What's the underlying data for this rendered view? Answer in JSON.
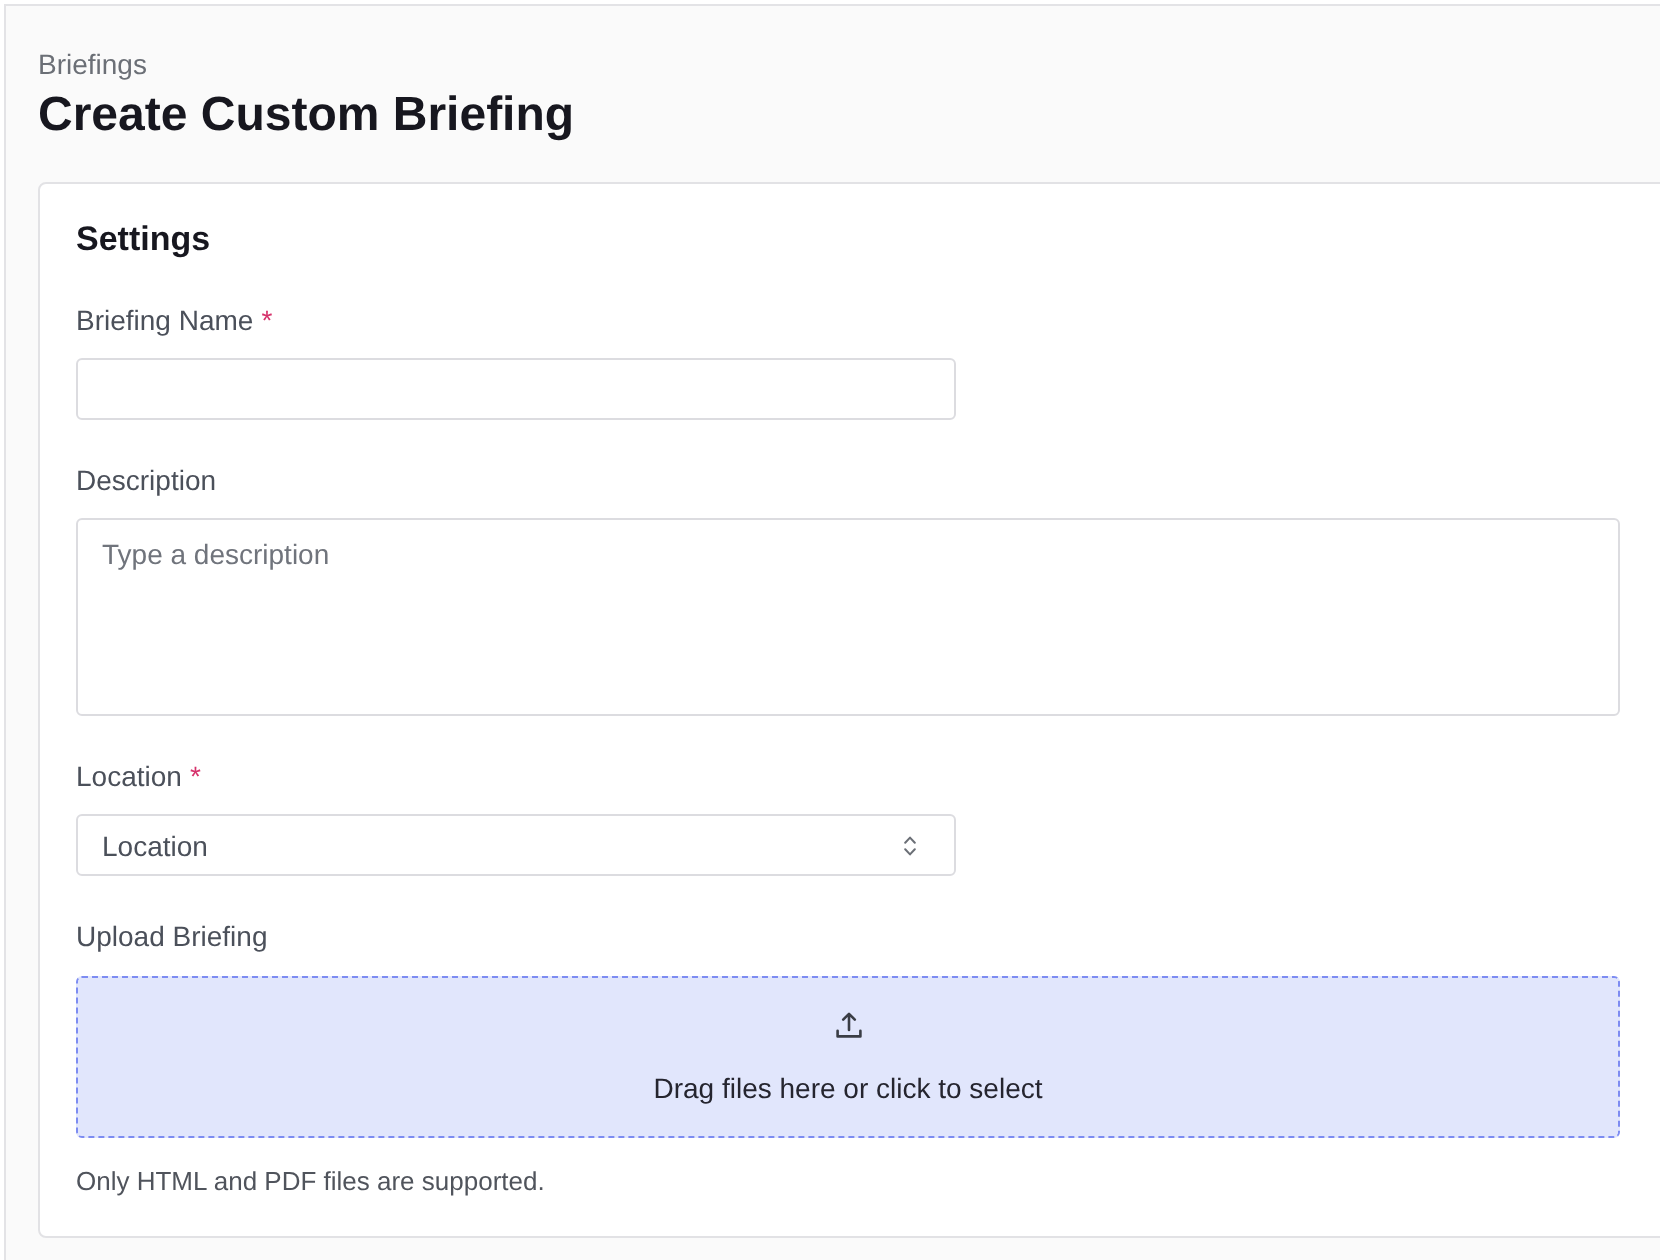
{
  "breadcrumb": "Briefings",
  "title": "Create Custom Briefing",
  "card": {
    "title": "Settings",
    "fields": [
      {
        "kind": "text",
        "label": "Briefing Name",
        "required_mark": "*"
      },
      {
        "kind": "textarea",
        "label": "Description",
        "placeholder": "Type a description"
      },
      {
        "kind": "select",
        "label": "Location",
        "required_mark": "*",
        "placeholder": "Location"
      },
      {
        "kind": "upload",
        "label": "Upload Briefing",
        "prompt": "Drag files here or click to select",
        "hint": "Only HTML and PDF files are supported."
      }
    ]
  }
}
